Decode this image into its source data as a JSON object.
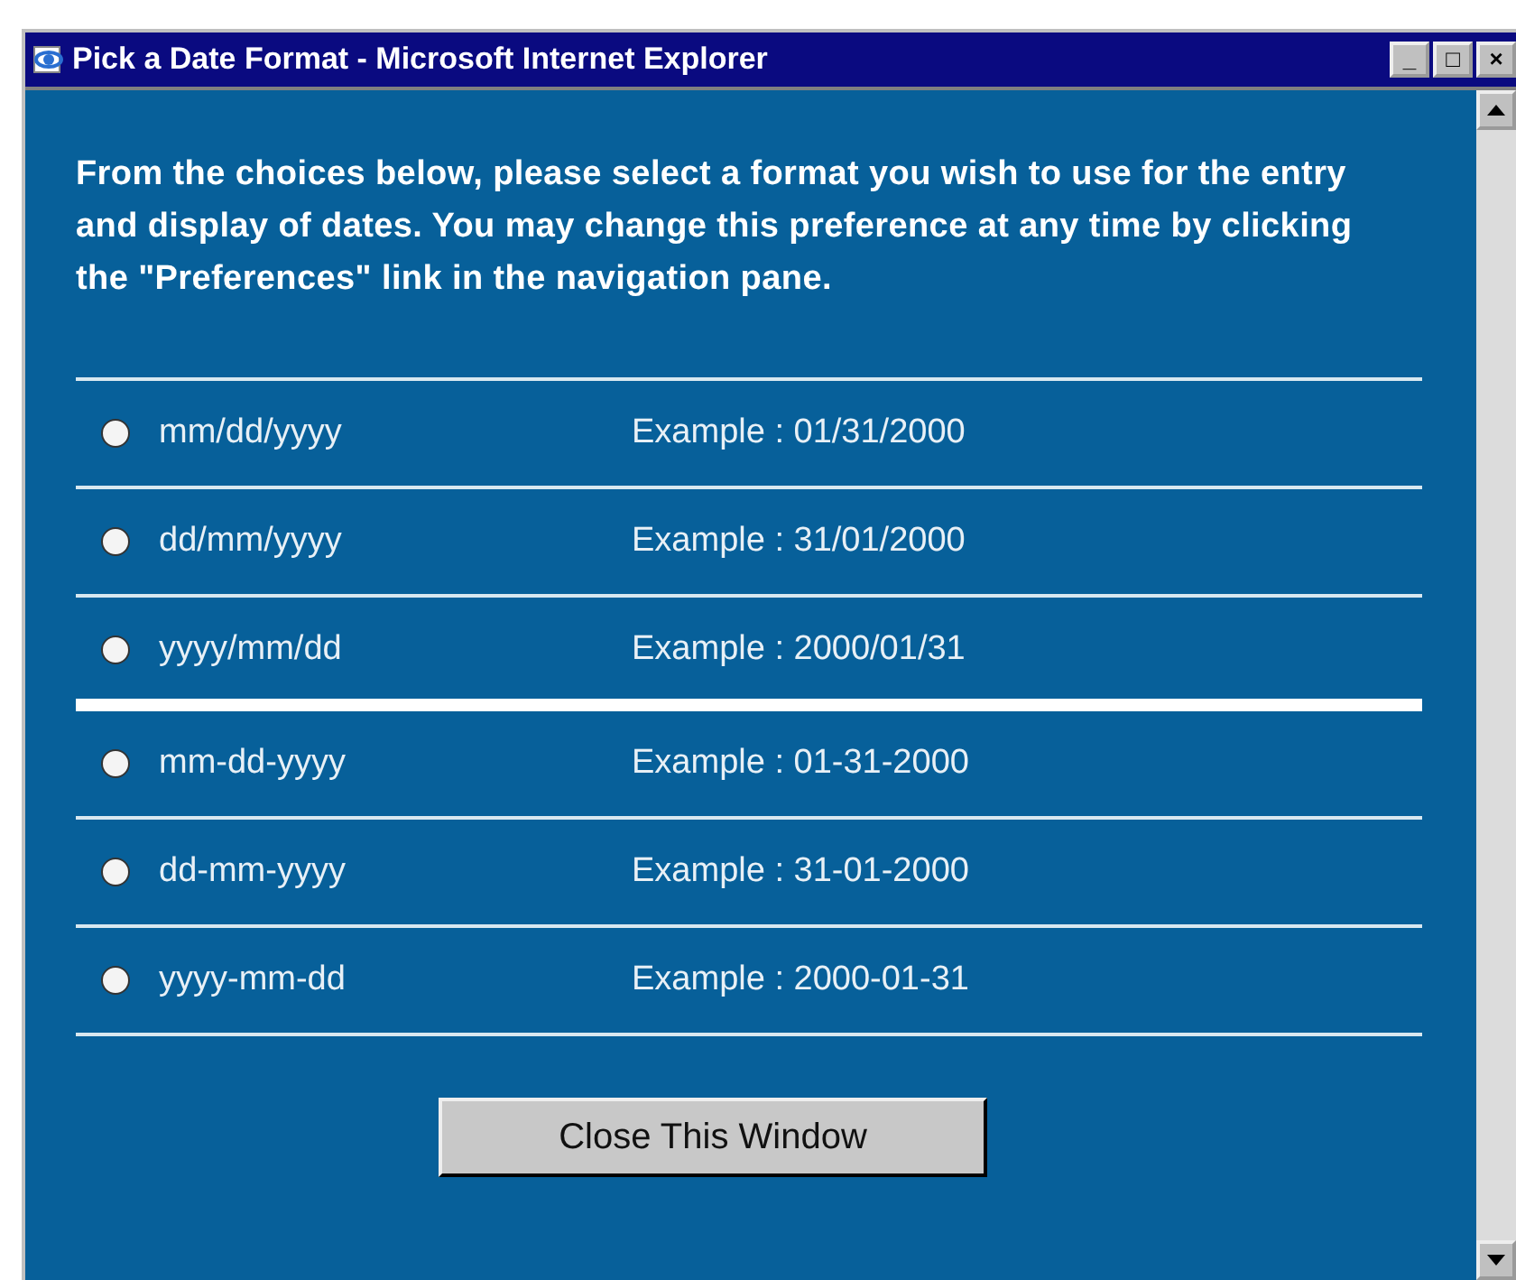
{
  "window": {
    "title": "Pick a Date Format - Microsoft Internet Explorer",
    "controls": [
      "_",
      "□",
      "×"
    ]
  },
  "intro": "From the choices below, please select a format you wish to use for the entry and display of dates. You may change this preference at any time by clicking the \"Preferences\" link in the navigation pane.",
  "groups": [
    {
      "formats": [
        {
          "format": "mm/dd/yyyy",
          "example": "Example : 01/31/2000",
          "selected": false
        },
        {
          "format": "dd/mm/yyyy",
          "example": "Example : 31/01/2000",
          "selected": false
        },
        {
          "format": "yyyy/mm/dd",
          "example": "Example : 2000/01/31",
          "selected": false
        }
      ]
    },
    {
      "formats": [
        {
          "format": "mm-dd-yyyy",
          "example": "Example : 01-31-2000",
          "selected": false
        },
        {
          "format": "dd-mm-yyyy",
          "example": "Example : 31-01-2000",
          "selected": false
        },
        {
          "format": "yyyy-mm-dd",
          "example": "Example : 2000-01-31",
          "selected": false
        }
      ]
    }
  ],
  "close_button": "Close This Window"
}
